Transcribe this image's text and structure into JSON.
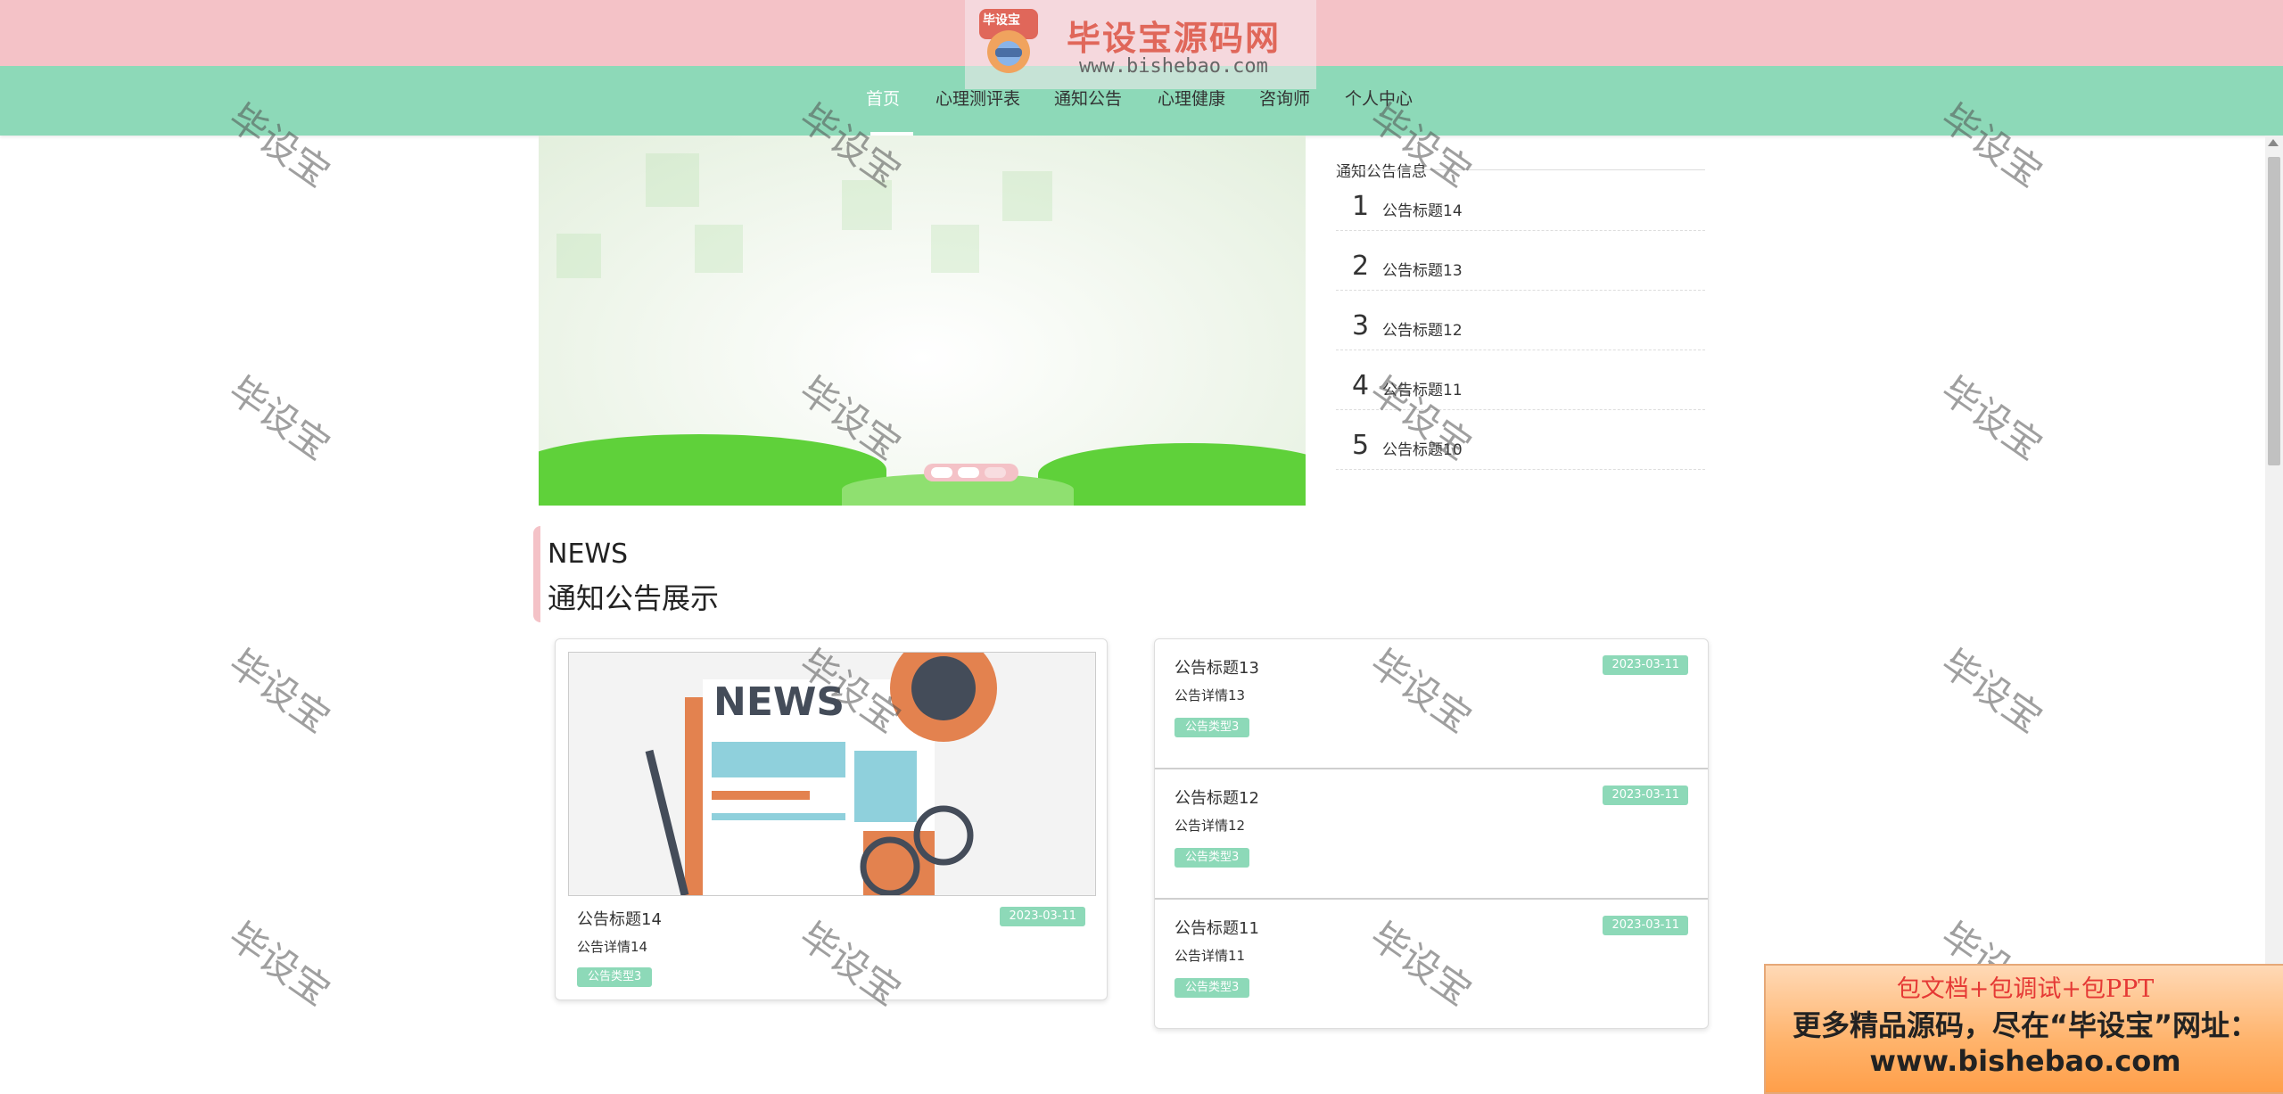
{
  "logo": {
    "title": "毕设宝源码网",
    "url": "www.bishebao.com",
    "badge_text": "毕设宝"
  },
  "nav": [
    {
      "label": "首页",
      "active": true
    },
    {
      "label": "心理测评表",
      "active": false
    },
    {
      "label": "通知公告",
      "active": false
    },
    {
      "label": "心理健康",
      "active": false
    },
    {
      "label": "咨询师",
      "active": false
    },
    {
      "label": "个人中心",
      "active": false
    }
  ],
  "sidebar": {
    "title": "通知公告信息",
    "items": [
      {
        "num": "1",
        "label": "公告标题14"
      },
      {
        "num": "2",
        "label": "公告标题13"
      },
      {
        "num": "3",
        "label": "公告标题12"
      },
      {
        "num": "4",
        "label": "公告标题11"
      },
      {
        "num": "5",
        "label": "公告标题10"
      }
    ]
  },
  "section": {
    "title": "NEWS",
    "subtitle": "通知公告展示"
  },
  "featured": {
    "title": "公告标题14",
    "detail": "公告详情14",
    "tag": "公告类型3",
    "date": "2023-03-11",
    "image_text": "NEWS"
  },
  "list": [
    {
      "title": "公告标题13",
      "detail": "公告详情13",
      "tag": "公告类型3",
      "date": "2023-03-11"
    },
    {
      "title": "公告标题12",
      "detail": "公告详情12",
      "tag": "公告类型3",
      "date": "2023-03-11"
    },
    {
      "title": "公告标题11",
      "detail": "公告详情11",
      "tag": "公告类型3",
      "date": "2023-03-11"
    }
  ],
  "watermark": "毕设宝",
  "promo": {
    "line1": "包文档+包调试+包PPT",
    "line2": "更多精品源码，尽在“毕设宝”网址：",
    "line3": "www.bishebao.com"
  },
  "colors": {
    "top_bar": "#f4c2c7",
    "nav_bar": "#8dd9b8",
    "tag": "#8dd9b8",
    "accent_pink": "#f4c2c7"
  }
}
